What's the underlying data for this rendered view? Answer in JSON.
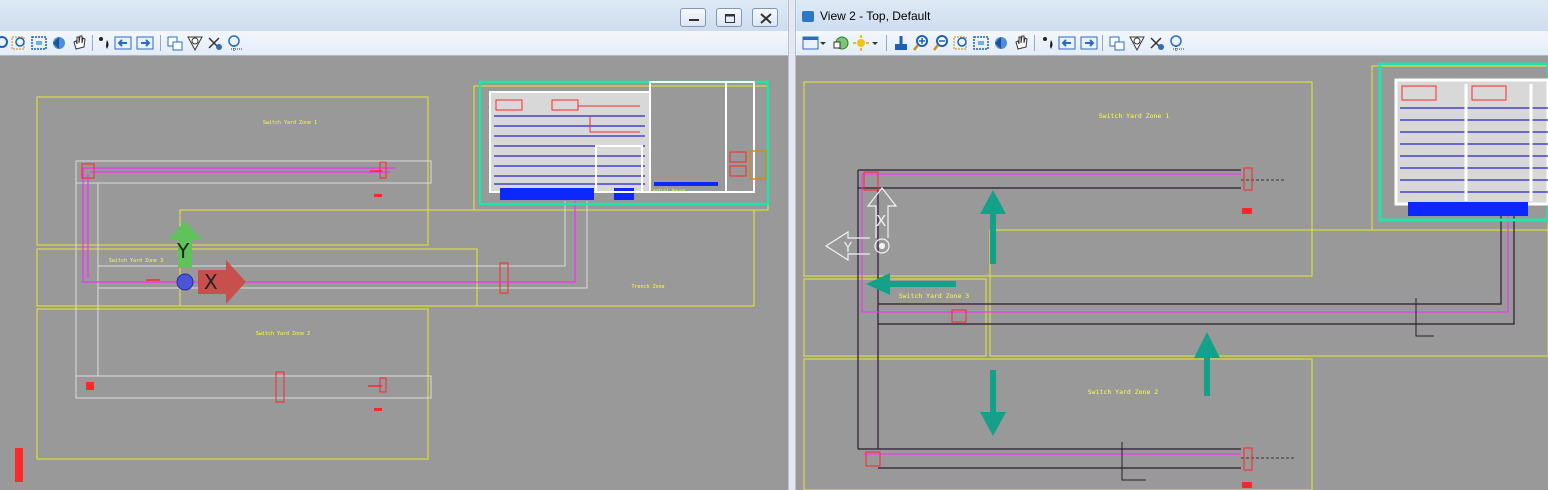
{
  "window1": {
    "minimize_icon": "minimize-icon",
    "maximize_icon": "restore-icon",
    "close_icon": "close-icon",
    "zones": {
      "zone1": "Switch Yard Zone 1",
      "zone2": "Switch Yard Zone 2",
      "zone3": "Switch Yard Zone 3",
      "trench": "Trench Zone",
      "building": "Control House"
    },
    "axis": {
      "x": "X",
      "y": "Y"
    }
  },
  "window2": {
    "title": "View 2 - Top, Default",
    "zones": {
      "zone1": "Switch Yard Zone 1",
      "zone2": "Switch Yard Zone 2",
      "zone3": "Switch Yard Zone 3"
    },
    "axis": {
      "x": "X",
      "y": "Y"
    }
  },
  "colors": {
    "zone": "#ffff3c",
    "pipe": "#ff28ff",
    "teal_arrow": "#15a08a",
    "green_outline": "#1ee6aa",
    "canvas": "#999999"
  }
}
